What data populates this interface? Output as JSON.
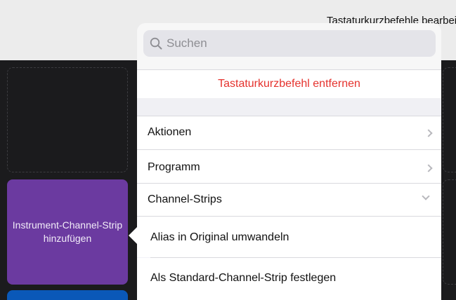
{
  "header": {
    "title": "Tastaturkurzbefehle bearbeiten"
  },
  "tiles": {
    "instrument_add": "Instrument-Channel-Strip hinzufügen"
  },
  "popover": {
    "search": {
      "placeholder": "Suchen"
    },
    "remove_shortcut": "Tastaturkurzbefehl entfernen",
    "items": [
      {
        "label": "Aktionen",
        "indicator": "chevron-right-icon"
      },
      {
        "label": "Programm",
        "indicator": "chevron-right-icon"
      },
      {
        "label": "Channel-Strips",
        "indicator": "chevron-down-icon"
      },
      {
        "label": "Alias in Original umwandeln"
      },
      {
        "label": "Als Standard-Channel-Strip festlegen"
      }
    ]
  },
  "colors": {
    "destructive": "#e5322d",
    "instrument_tile": "#6b3aa0",
    "audio_tile": "#0a58b8"
  }
}
